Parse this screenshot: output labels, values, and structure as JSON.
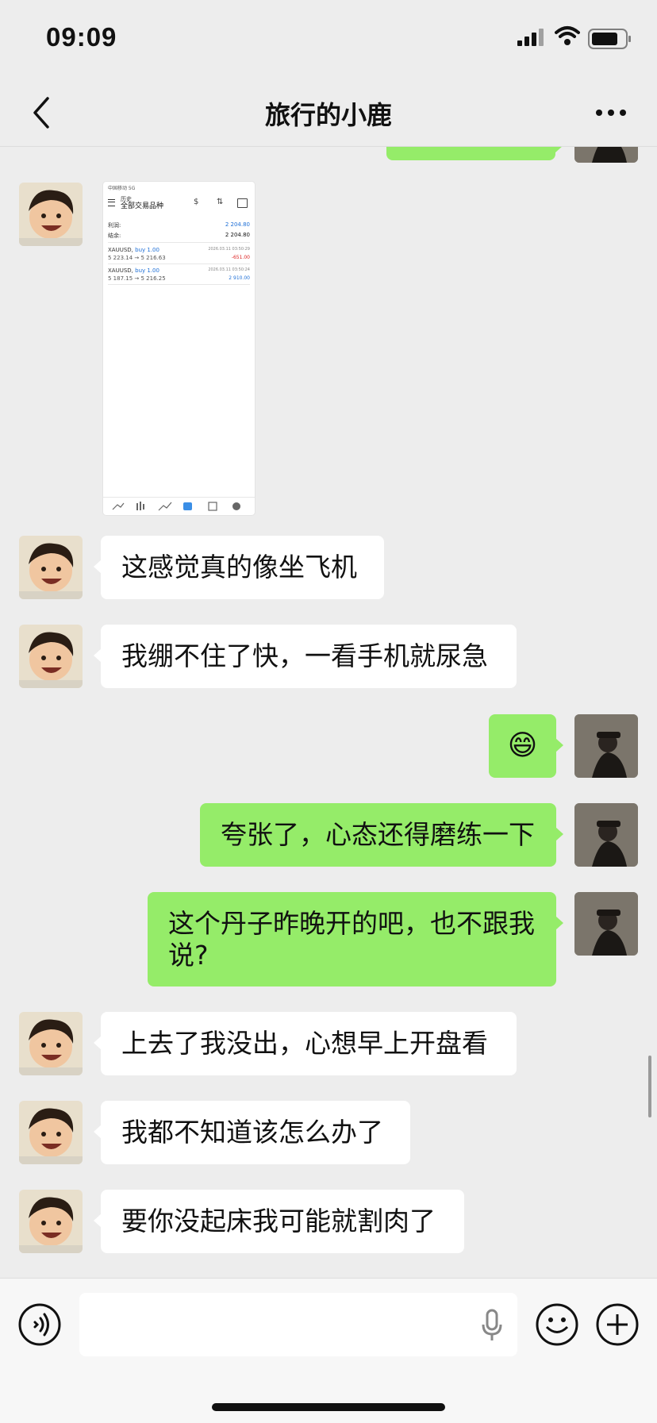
{
  "status_bar": {
    "time": "09:09"
  },
  "header": {
    "title": "旅行的小鹿",
    "back_icon": "chevron-left-icon",
    "more_icon": "more-horizontal-icon"
  },
  "colors": {
    "background": "#ededed",
    "incoming_bubble": "#ffffff",
    "outgoing_bubble": "#95ec69"
  },
  "screenshot_attachment": {
    "status": "中国移动 5G",
    "subtitle": "历史",
    "title": "全部交易品种",
    "profit_label": "利润:",
    "profit_value": "2 204.80",
    "balance_label": "结余:",
    "balance_value": "2 204.80",
    "trades": [
      {
        "symbol": "XAUUSD,",
        "side": "buy 1.00",
        "prices": "5 223.14 → 5 216.63",
        "time": "2026.03.11 03:50:29",
        "pnl": "-651.00"
      },
      {
        "symbol": "XAUUSD,",
        "side": "buy 1.00",
        "prices": "5 187.15 → 5 216.25",
        "time": "2026.03.11 03:50:24",
        "pnl": "2 910.00"
      }
    ]
  },
  "messages": [
    {
      "side": "in",
      "text": "这感觉真的像坐飞机"
    },
    {
      "side": "in",
      "text": "我绷不住了快，一看手机就尿急"
    },
    {
      "side": "out",
      "emoji": "😄",
      "emoji_name": "grinning-emoji"
    },
    {
      "side": "out",
      "text": "夸张了，心态还得磨练一下"
    },
    {
      "side": "out",
      "text": "这个丹子昨晚开的吧，也不跟我说?"
    },
    {
      "side": "in",
      "text": "上去了我没出，心想早上开盘看"
    },
    {
      "side": "in",
      "text": "我都不知道该怎么办了"
    },
    {
      "side": "in",
      "text": "要你没起床我可能就割肉了"
    }
  ],
  "composer": {
    "voice_icon": "voice-mode-icon",
    "mic_icon": "microphone-icon",
    "emoji_icon": "emoji-icon",
    "plus_icon": "plus-icon"
  }
}
